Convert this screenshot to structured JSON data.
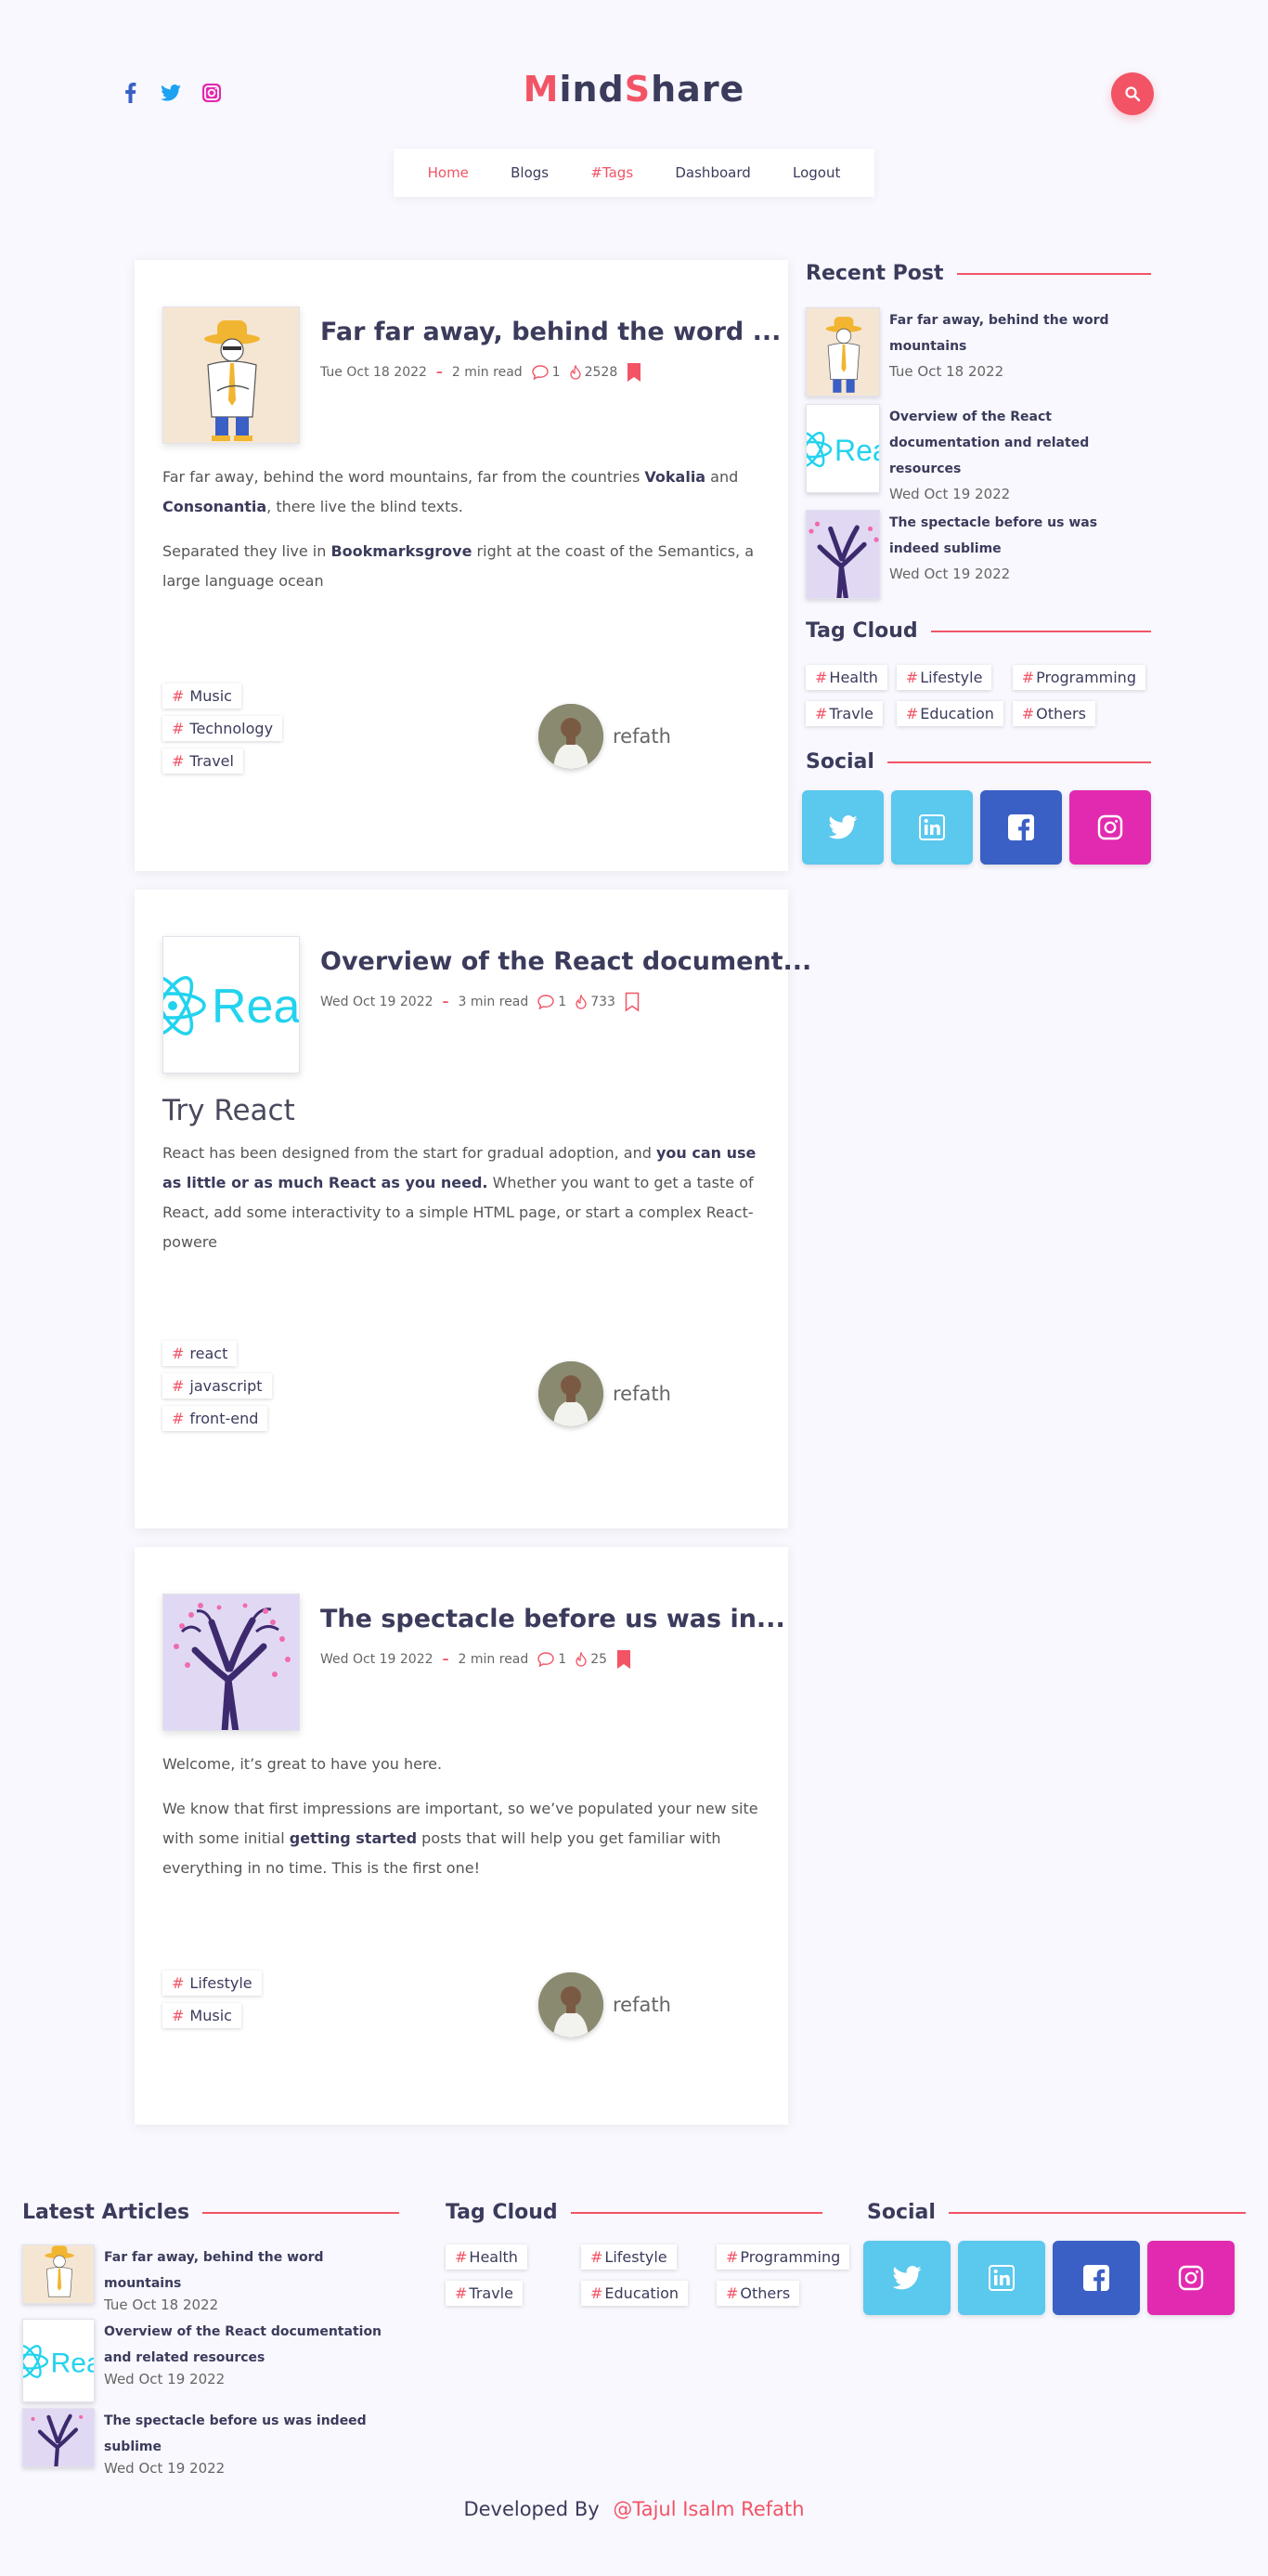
{
  "brand": {
    "part1": "M",
    "part2": "ind",
    "part3": "S",
    "part4": "hare",
    "accent": "#f25466"
  },
  "header_social": [
    "facebook-icon",
    "twitter-icon",
    "instagram-icon"
  ],
  "nav": [
    {
      "label": "Home"
    },
    {
      "label": "Blogs"
    },
    {
      "label": "#Tags"
    },
    {
      "label": "Dashboard"
    },
    {
      "label": "Logout"
    }
  ],
  "posts": [
    {
      "title": "Far far away, behind the word ...",
      "date": "Tue Oct 18 2022",
      "read": "2 min read",
      "comments": "1",
      "views": "2528",
      "bookmarked": true,
      "excerpt_1a": "Far far away, behind the word mountains, far from the countries ",
      "excerpt_1b": "Vokalia",
      "excerpt_1c": " and ",
      "excerpt_1d": "Consonantia",
      "excerpt_1e": ", there live the blind texts.",
      "excerpt_2a": "Separated they live in ",
      "excerpt_2b": "Bookmarksgrove",
      "excerpt_2c": " right at the coast of the Semantics, a large language ocean",
      "tags": [
        "Music",
        "Technology",
        "Travel"
      ],
      "author": "refath"
    },
    {
      "title": "Overview of the React document...",
      "date": "Wed Oct 19 2022",
      "read": "3 min read",
      "comments": "1",
      "views": "733",
      "bookmarked": false,
      "heading": "Try React",
      "excerpt_1a": "React has been designed from the start for gradual adoption, and ",
      "excerpt_1b": "you can use as little or as much React as you need.",
      "excerpt_1c": " Whether you want to get a taste of React, add some interactivity to a simple HTML page, or start a complex React-powere",
      "thumb_text": "Rea",
      "tags": [
        "react",
        "javascript",
        "front-end"
      ],
      "author": "refath"
    },
    {
      "title": "The spectacle before us was in...",
      "date": "Wed Oct 19 2022",
      "read": "2 min read",
      "comments": "1",
      "views": "25",
      "bookmarked": true,
      "excerpt_0": "Welcome, it’s great to have you here.",
      "excerpt_1a": "We know that first impressions are important, so we’ve populated your new site with some initial ",
      "excerpt_1b": "getting started",
      "excerpt_1c": " posts that will help you get familiar with everything in no time. This is the first one!",
      "tags": [
        "Lifestyle",
        "Music"
      ],
      "author": "refath"
    }
  ],
  "sidebar": {
    "recent_title": "Recent Post",
    "recent": [
      {
        "title": "Far far away, behind the word mountains",
        "date": "Tue Oct 18 2022"
      },
      {
        "title": "Overview of the React documentation and related resources",
        "date": "Wed Oct 19 2022"
      },
      {
        "title": "The spectacle before us was indeed sublime",
        "date": "Wed Oct 19 2022"
      }
    ],
    "tag_title": "Tag Cloud",
    "tags": [
      "Health",
      "Lifestyle",
      "Programming",
      "Travle",
      "Education",
      "Others"
    ],
    "social_title": "Social"
  },
  "footer": {
    "latest_title": "Latest Articles",
    "tag_title": "Tag Cloud",
    "social_title": "Social",
    "credit_prefix": "Developed By",
    "credit_name": "@Tajul Isalm Refath"
  },
  "social_colors": {
    "twitter": "#5bc8ee",
    "linkedin": "#5bc8ee",
    "facebook": "#3a5fc5",
    "instagram": "#e22ab0"
  }
}
